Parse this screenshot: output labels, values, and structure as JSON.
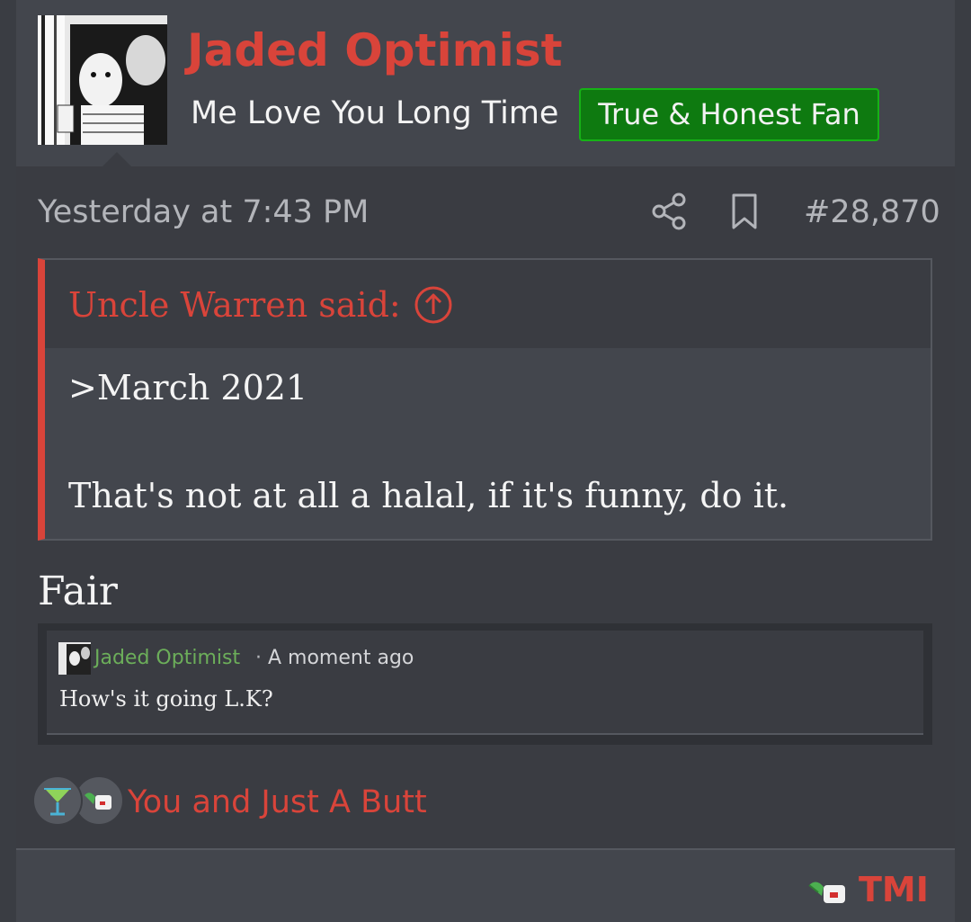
{
  "author": {
    "name": "Jaded Optimist",
    "title": "Me Love You Long Time",
    "banner": "True & Honest Fan"
  },
  "post": {
    "timestamp": "Yesterday at 7:43 PM",
    "number": "#28,870",
    "message": "Fair"
  },
  "quote": {
    "attribution": "Uncle Warren said:",
    "lines": [
      ">March 2021",
      "That's not at all a halal, if it's funny, do it."
    ]
  },
  "comment": {
    "author": "Jaded Optimist",
    "separator": "·",
    "time": "A moment ago",
    "text": "How's it going L.K?"
  },
  "reactions": {
    "text": "You and Just A Butt",
    "icons": [
      "cocktail-icon",
      "dumb-italy-icon"
    ]
  },
  "footer": {
    "reaction_label": "TMI",
    "icon": "dumb-italy-icon"
  },
  "colors": {
    "accent": "#d9443a",
    "banner_bg": "#0e7a10",
    "comment_author": "#6cae5a"
  }
}
